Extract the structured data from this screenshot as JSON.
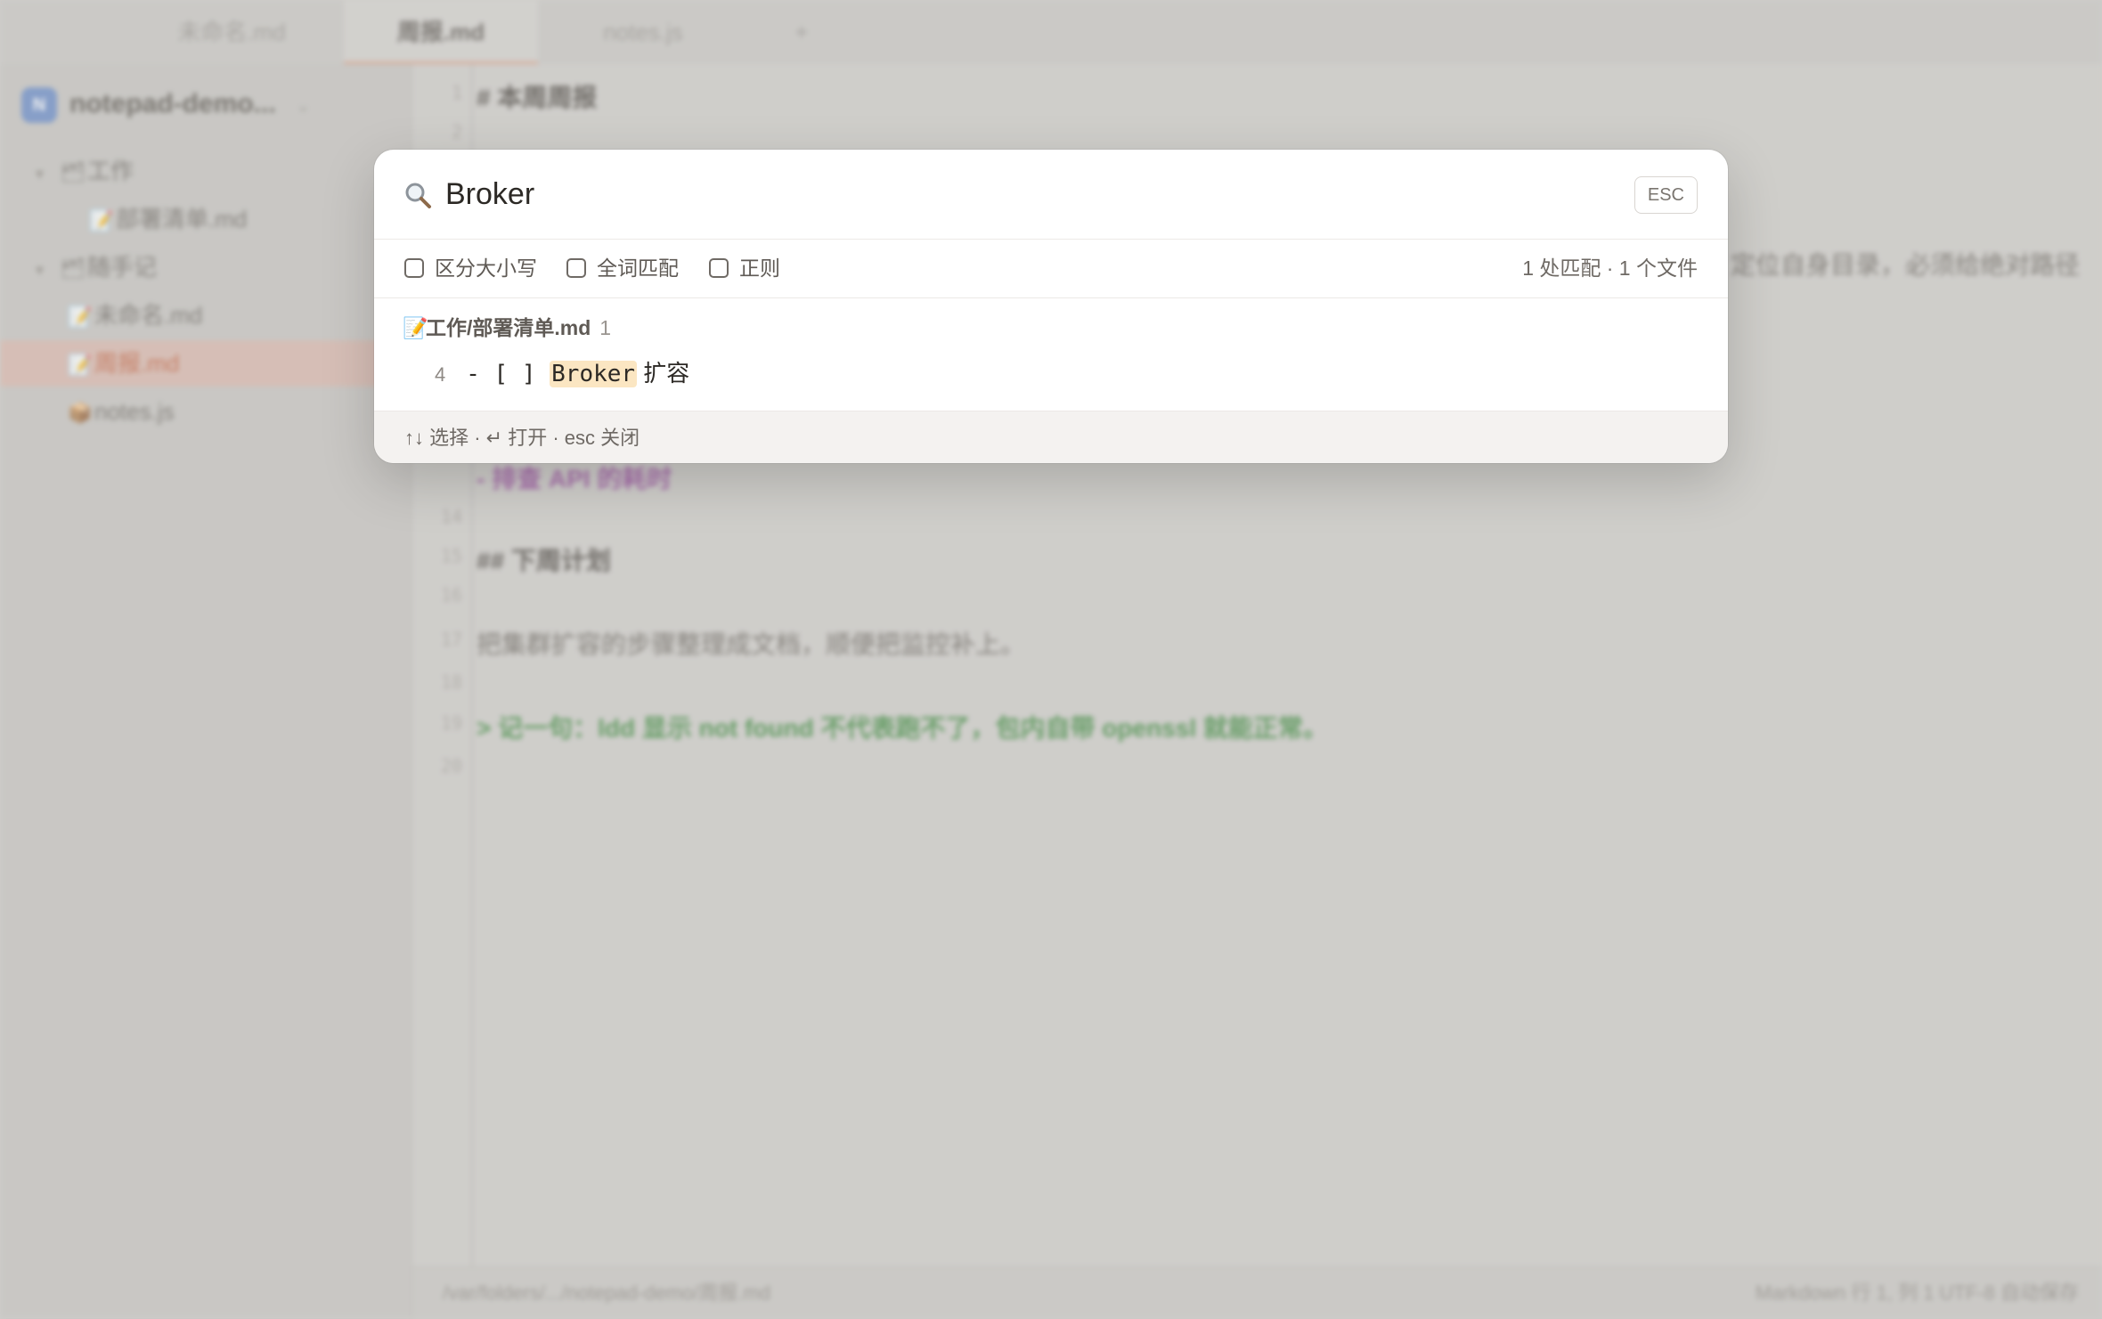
{
  "tabs": [
    {
      "label": "未命名.md",
      "active": false
    },
    {
      "label": "周报.md",
      "active": true
    },
    {
      "label": "notes.js",
      "active": false
    },
    {
      "label": "+",
      "active": false
    }
  ],
  "sidebar": {
    "workspace_name": "notepad-demo...",
    "workspace_initial": "N",
    "tree": [
      {
        "label": "工作",
        "type": "folder"
      },
      {
        "label": "部署清单.md",
        "type": "file"
      },
      {
        "label": "随手记",
        "type": "folder"
      },
      {
        "label": "未命名.md",
        "type": "file"
      },
      {
        "label": "周报.md",
        "type": "file",
        "selected": true
      },
      {
        "label": "notes.js",
        "type": "file"
      }
    ]
  },
  "editor": {
    "lines": [
      {
        "n": "1",
        "text": "# 本周周报"
      },
      {
        "n": "2",
        "text": ""
      },
      {
        "n": "",
        "text": "定位自身目录，必须给绝对路径"
      },
      {
        "n": "",
        "text": "- 排查 API 的耗时"
      },
      {
        "n": "14",
        "text": ""
      },
      {
        "n": "15",
        "text": "## 下周计划"
      },
      {
        "n": "16",
        "text": ""
      },
      {
        "n": "17",
        "text": "把集群扩容的步骤整理成文档，顺便把监控补上。"
      },
      {
        "n": "18",
        "text": ""
      },
      {
        "n": "19",
        "text": "> 记一句：ldd 显示 not found 不代表跑不了，包内自带 openssl 就能正常。"
      },
      {
        "n": "20",
        "text": ""
      }
    ]
  },
  "statusbar": {
    "path": "/var/folders/.../notepad-demo/周报.md",
    "right": "Markdown   行 1, 列 1   UTF-8   自动保存"
  },
  "search": {
    "query": "Broker",
    "esc_label": "ESC",
    "options": [
      {
        "label": "区分大小写",
        "checked": false
      },
      {
        "label": "全词匹配",
        "checked": false
      },
      {
        "label": "正则",
        "checked": false
      }
    ],
    "summary": "1 处匹配 · 1 个文件",
    "results": [
      {
        "file": "工作/部署清单.md",
        "count": "1",
        "hits": [
          {
            "line": "4",
            "before": "- [ ] ",
            "match": "Broker",
            "after": " 扩容"
          }
        ]
      }
    ],
    "footer": "↑↓ 选择 · ↵ 打开 · esc 关闭"
  },
  "colors": {
    "accent": "#c25e3c",
    "match_highlight": "#fbe6c2"
  }
}
